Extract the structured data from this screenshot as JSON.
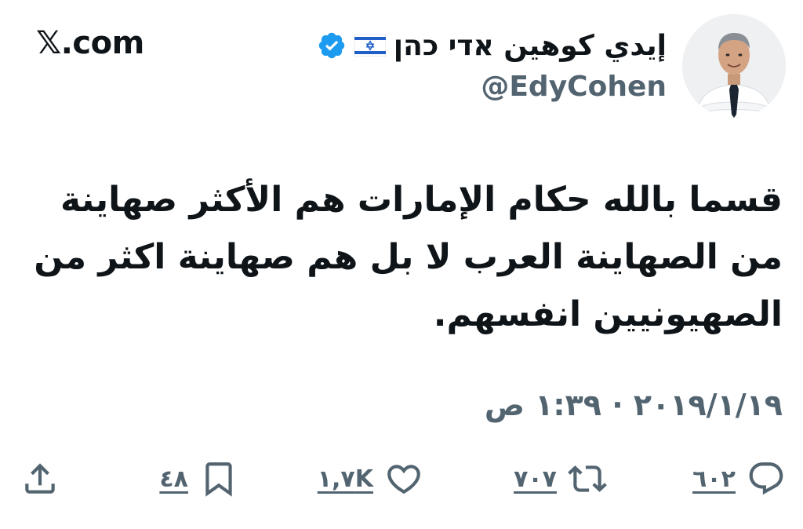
{
  "brand": {
    "label": "𝕏.com"
  },
  "author": {
    "display_name": "إيدي كوهين אדי כהן",
    "handle": "@EdyCohen",
    "flag_icon": "israel-flag-icon",
    "verified_icon": "verified-badge-icon",
    "verified_color": "#1d9bf0"
  },
  "tweet": {
    "text_lines": [
      "قسما بالله حكام الإمارات هم الأكثر صهاينة",
      "من الصهاينة العرب لا بل هم صهاينة اكثر من",
      "الصهيونيين انفسهم."
    ],
    "timestamp": "٢٠١٩/١/١٩ · ١:٣٩ ص"
  },
  "actions": {
    "reply": {
      "icon": "reply-icon",
      "count": "٦٠٢"
    },
    "retweet": {
      "icon": "retweet-icon",
      "count": "٧٠٧"
    },
    "like": {
      "icon": "heart-icon",
      "count": "١,٧K"
    },
    "bookmark": {
      "icon": "bookmark-icon",
      "count": "٤٨"
    },
    "share": {
      "icon": "share-icon"
    }
  },
  "colors": {
    "text_primary": "#0f1419",
    "text_secondary": "#536471",
    "background": "#ffffff"
  }
}
